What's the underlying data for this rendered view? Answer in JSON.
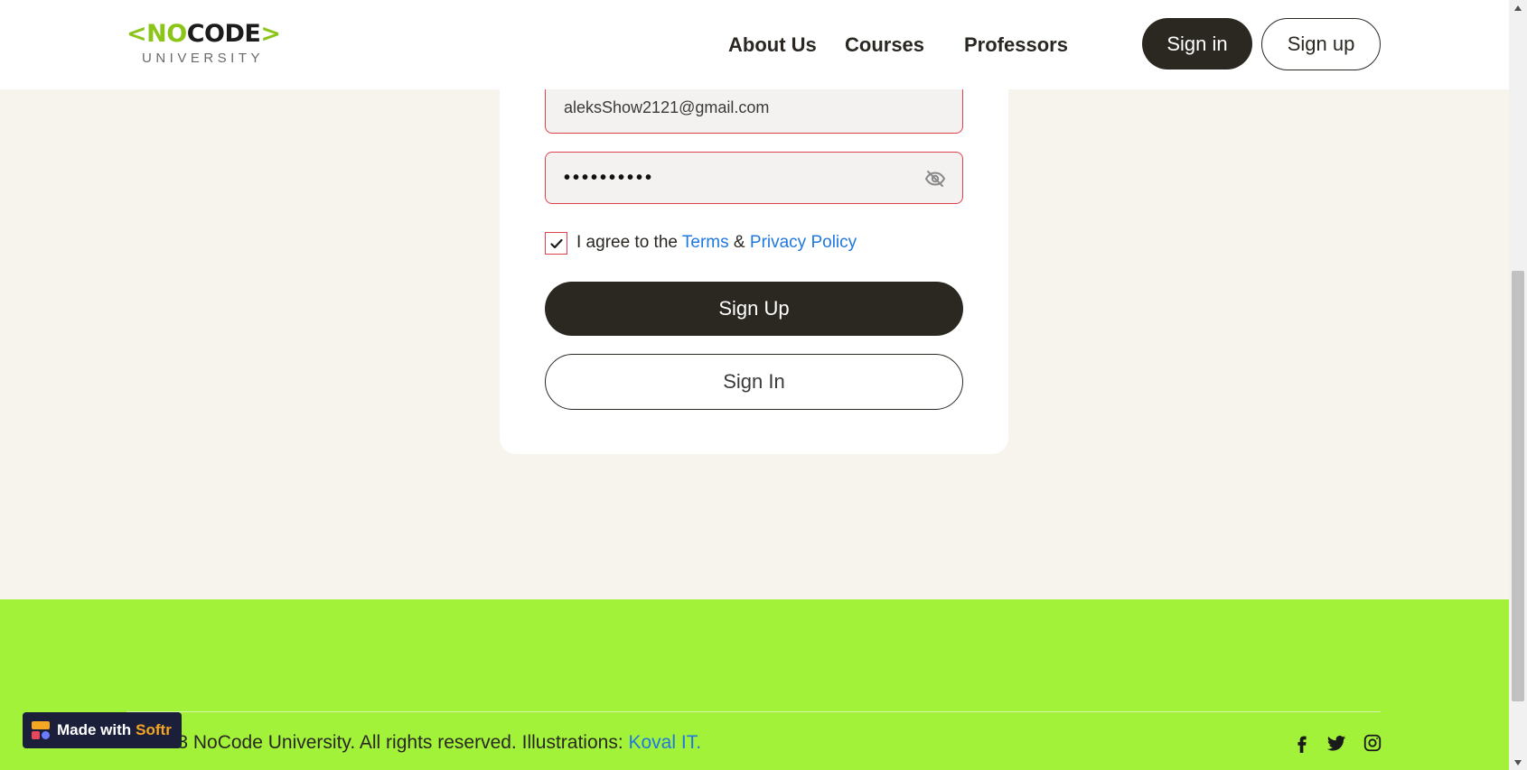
{
  "header": {
    "logo": {
      "bracket_open": "<",
      "no": "NO",
      "code": "CODE",
      "bracket_close": ">",
      "sub": "UNIVERSITY"
    },
    "nav": [
      "About Us",
      "Courses",
      "Professors"
    ],
    "sign_in_label": "Sign in",
    "sign_up_label": "Sign up"
  },
  "form": {
    "email_value": "aleksShow2121@gmail.com",
    "password_mask": "••••••••••",
    "password_visibility_icon": "eye-off-icon",
    "agree": {
      "prefix": "I agree to the",
      "terms": "Terms",
      "amp": "&",
      "privacy": "Privacy Policy",
      "checked": true
    },
    "sign_up_label": "Sign Up",
    "sign_in_label": "Sign In"
  },
  "footer": {
    "copyright_text": "© 2023 NoCode University. All rights reserved. Illustrations:",
    "illustrations_link": "Koval IT.",
    "social_icons": [
      "facebook-icon",
      "twitter-icon",
      "instagram-icon"
    ]
  },
  "badge": {
    "prefix": "Made with",
    "brand": "Softr"
  },
  "colors": {
    "accent_green": "#a3f23a",
    "logo_green": "#8cc519",
    "dark": "#2b2822",
    "error_border": "#e0414e",
    "link": "#1f78e0",
    "page_bg": "#f7f4ee"
  }
}
